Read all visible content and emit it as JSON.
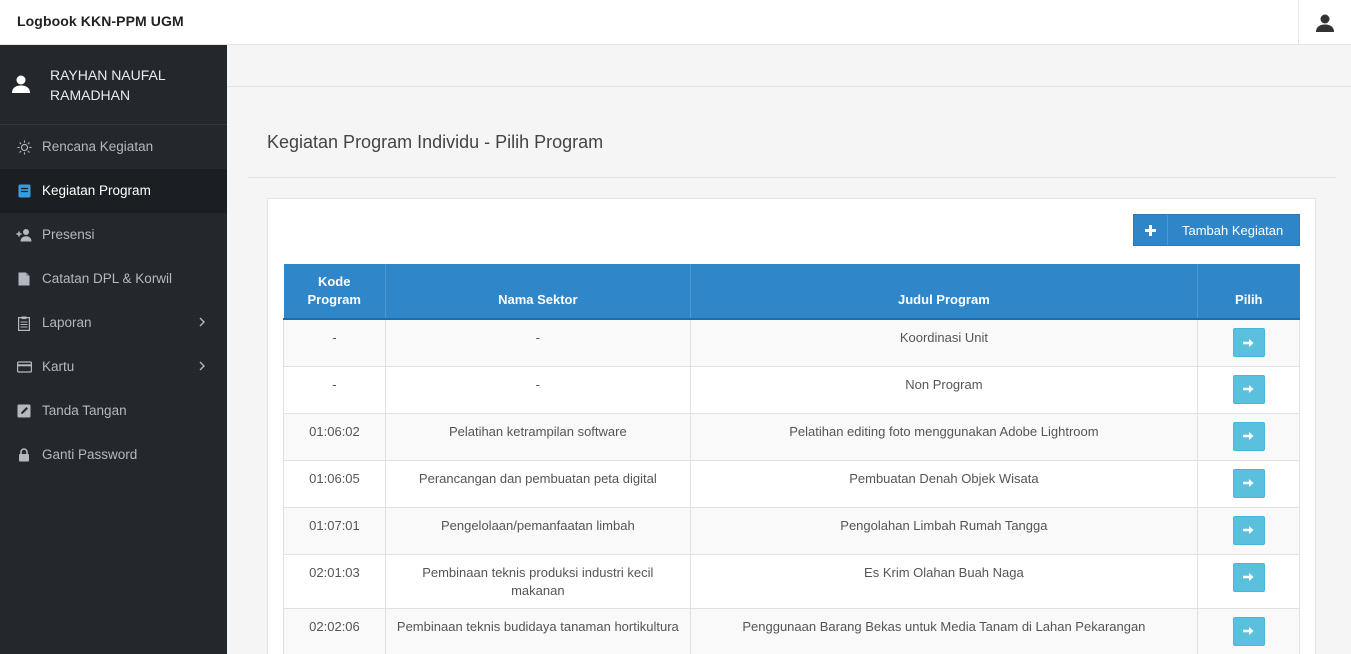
{
  "header": {
    "title": "Logbook KKN-PPM UGM",
    "user_icon": "user-icon"
  },
  "sidebar": {
    "user_name": "RAYHAN NAUFAL RAMADHAN",
    "items": [
      {
        "label": "Rencana Kegiatan",
        "icon": "lightbulb-icon"
      },
      {
        "label": "Kegiatan Program",
        "icon": "book-icon",
        "active": true
      },
      {
        "label": "Presensi",
        "icon": "user-plus-icon"
      },
      {
        "label": "Catatan DPL & Korwil",
        "icon": "document-icon"
      },
      {
        "label": "Laporan",
        "icon": "clipboard-icon",
        "has_submenu": true
      },
      {
        "label": "Kartu",
        "icon": "credit-card-icon",
        "has_submenu": true
      },
      {
        "label": "Tanda Tangan",
        "icon": "edit-icon"
      },
      {
        "label": "Ganti Password",
        "icon": "lock-icon"
      }
    ]
  },
  "main": {
    "title": "Kegiatan Program Individu - Pilih Program",
    "add_button": {
      "label": "Tambah Kegiatan",
      "icon": "plus-icon"
    },
    "table": {
      "headers": [
        "Kode Program",
        "Nama Sektor",
        "Judul Program",
        "Pilih"
      ],
      "rows": [
        [
          "-",
          "-",
          "Koordinasi Unit"
        ],
        [
          "-",
          "-",
          "Non Program"
        ],
        [
          "01:06:02",
          "Pelatihan ketrampilan software",
          "Pelatihan editing foto menggunakan Adobe Lightroom"
        ],
        [
          "01:06:05",
          "Perancangan dan pembuatan peta digital",
          "Pembuatan Denah Objek Wisata"
        ],
        [
          "01:07:01",
          "Pengelolaan/pemanfaatan limbah",
          "Pengolahan Limbah Rumah Tangga"
        ],
        [
          "02:01:03",
          "Pembinaan teknis produksi industri kecil makanan",
          "Es Krim Olahan Buah Naga"
        ],
        [
          "02:02:06",
          "Pembinaan teknis budidaya tanaman hortikultura",
          "Penggunaan Barang Bekas untuk Media Tanam di Lahan Pekarangan"
        ]
      ]
    }
  },
  "colors": {
    "sidebar_bg": "#24282d",
    "accent": "#2f86c8",
    "pick_button": "#5bc0de"
  }
}
